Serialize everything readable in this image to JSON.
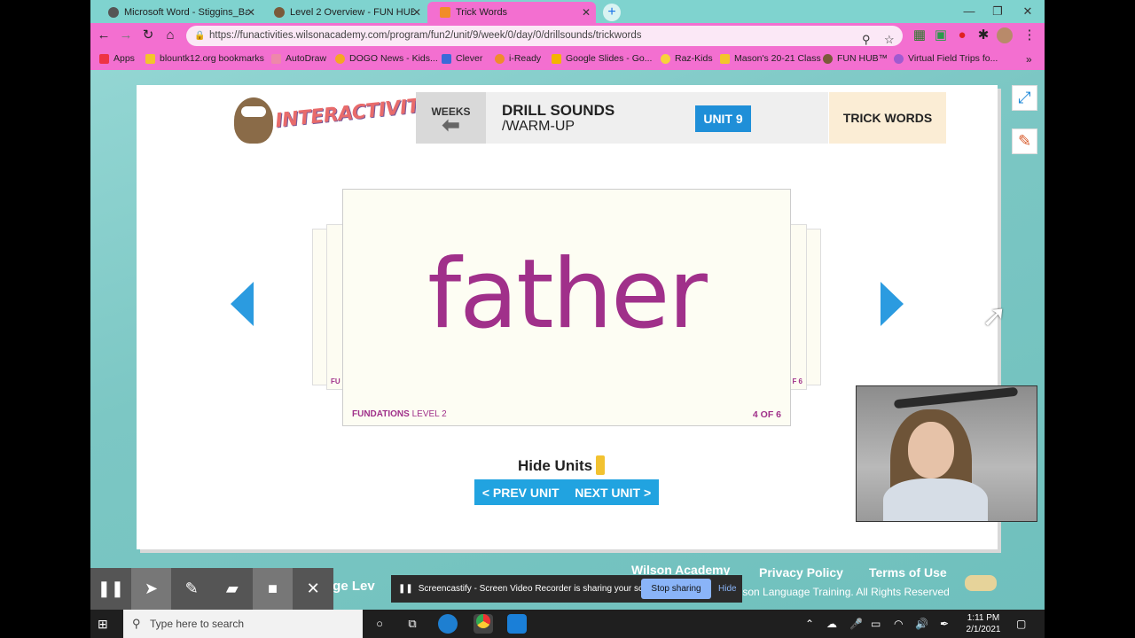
{
  "browser": {
    "tabs": [
      {
        "title": "Microsoft Word - Stiggins_Balan...",
        "active": false
      },
      {
        "title": "Level 2 Overview - FUN HUB™",
        "active": false
      },
      {
        "title": "Trick Words",
        "active": true
      }
    ],
    "url": "https://funactivities.wilsonacademy.com/program/fun2/unit/9/week/0/day/0/drillsounds/trickwords",
    "bookmarks": [
      "Apps",
      "blountk12.org bookmarks",
      "AutoDraw",
      "DOGO News - Kids...",
      "Clever",
      "i-Ready",
      "Google Slides - Go...",
      "Raz-Kids",
      "Mason's 20-21 Class",
      "FUN HUB™",
      "Virtual Field Trips fo..."
    ],
    "bookmarks_more": "»",
    "colors": {
      "chrome": "#f36fd0",
      "tabstrip": "#7fd3cf"
    }
  },
  "page": {
    "logo_text": "INTERACTIVITIES",
    "weeks_label": "WEEKS",
    "drill_title": "DRILL SOUNDS",
    "drill_subtitle": "/WARM-UP",
    "unit_badge": "UNIT 9",
    "trick_words": "TRICK WORDS",
    "card": {
      "word": "father",
      "brand": "FUNDATIONS",
      "level": "LEVEL 2",
      "count": "4 OF 6",
      "behind_left": "FU",
      "behind_right": "F 6"
    },
    "hide_units": "Hide Units",
    "prev_unit": "< PREV UNIT",
    "next_unit": "NEXT UNIT >",
    "footer": {
      "wilson": "Wilson Academy",
      "privacy": "Privacy Policy",
      "terms": "Terms of Use",
      "copyright": "ilson Language Training. All Rights Reserved",
      "change_level": "nge Lev"
    },
    "colors": {
      "word": "#a0308a",
      "accent_blue": "#21a3e0",
      "teal_bg": "#7fcbc8"
    }
  },
  "screencastify": {
    "share_text": "Screencastify - Screen Video Recorder is sharing your screen.",
    "stop_sharing": "Stop sharing",
    "hide": "Hide"
  },
  "taskbar": {
    "search_placeholder": "Type here to search",
    "time": "1:11 PM",
    "date": "2/1/2021"
  }
}
